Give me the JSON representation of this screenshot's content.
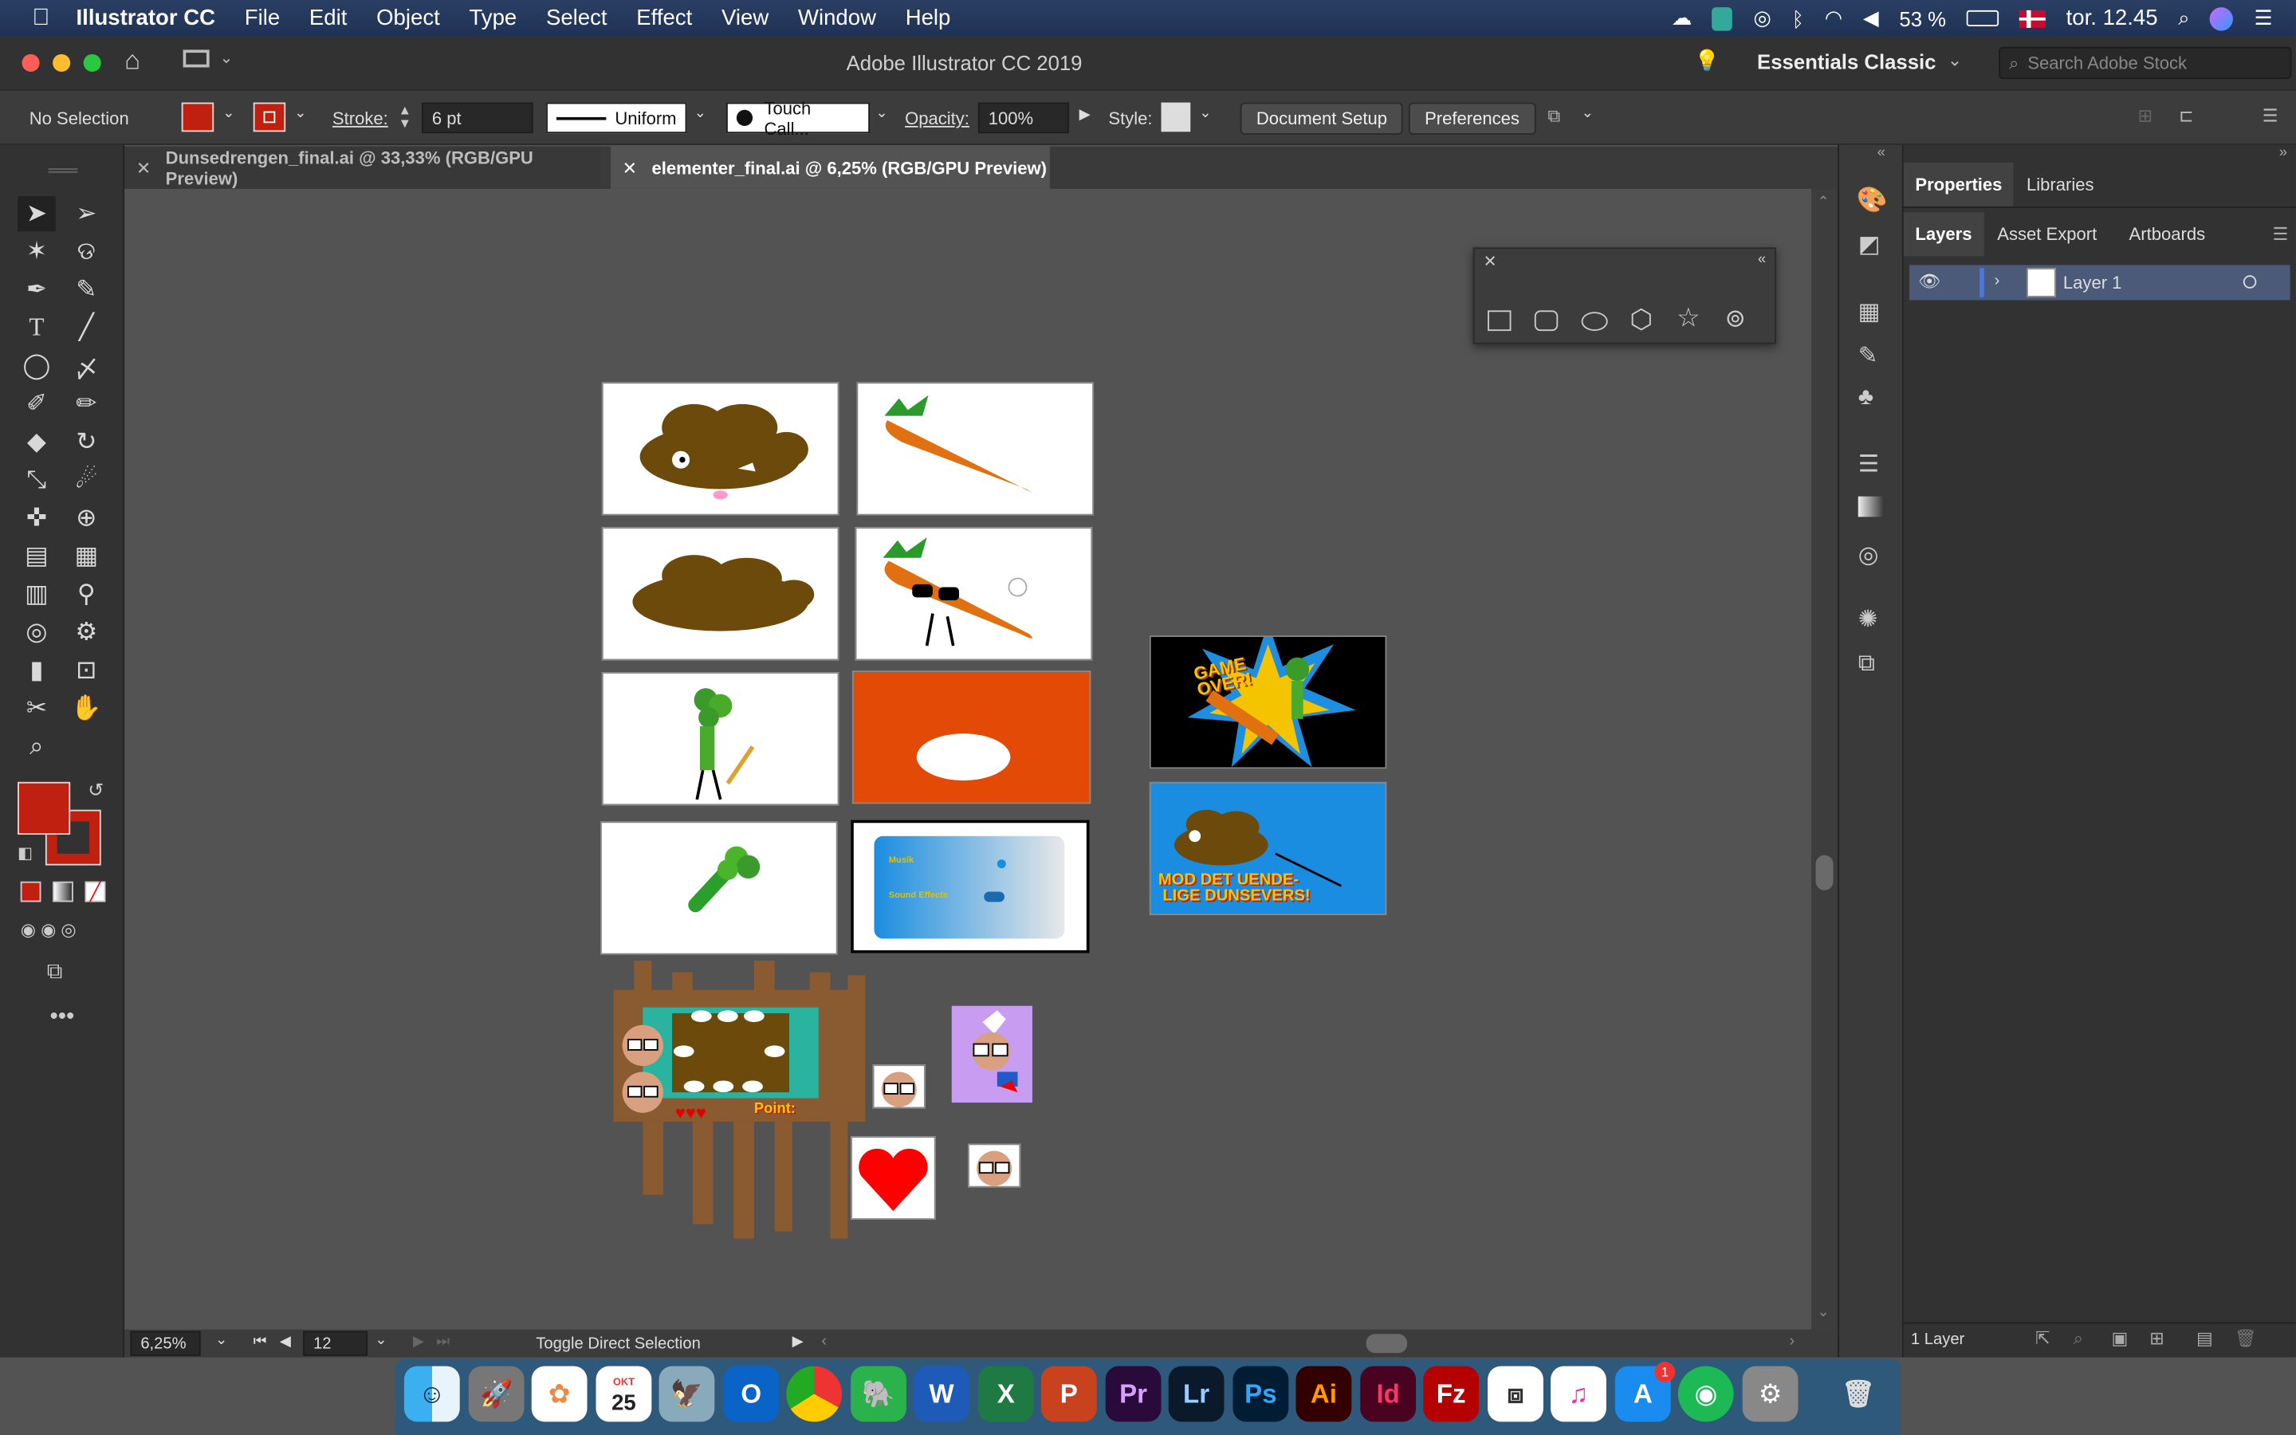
{
  "menubar": {
    "app": "Illustrator CC",
    "items": [
      "File",
      "Edit",
      "Object",
      "Type",
      "Select",
      "Effect",
      "View",
      "Window",
      "Help"
    ],
    "battery": "53 %",
    "clock": "tor. 12.45"
  },
  "titlebar": {
    "title": "Adobe Illustrator CC 2019",
    "workspace": "Essentials Classic",
    "search_placeholder": "Search Adobe Stock"
  },
  "control": {
    "selection": "No Selection",
    "stroke_label": "Stroke:",
    "stroke_value": "6 pt",
    "profile": "Uniform",
    "brush": "Touch Call...",
    "opacity_label": "Opacity:",
    "opacity_value": "100%",
    "style_label": "Style:",
    "doc_setup": "Document Setup",
    "preferences": "Preferences"
  },
  "tabs": [
    {
      "label": "Dunsedrengen_final.ai @ 33,33% (RGB/GPU Preview)"
    },
    {
      "label": "elementer_final.ai @ 6,25% (RGB/GPU Preview)"
    }
  ],
  "status": {
    "zoom": "6,25%",
    "artboard": "12",
    "message": "Toggle Direct Selection"
  },
  "panel": {
    "tabs": [
      "Properties",
      "Libraries"
    ],
    "subtabs": [
      "Layers",
      "Asset Export",
      "Artboards"
    ],
    "layer_name": "Layer 1",
    "footer": "1 Layer"
  },
  "artwork": {
    "gameover": "GAME OVER!",
    "title_line1": "MOD DET UENDE-",
    "title_line2": "LIGE DUNSEVERS!",
    "menu_music": "Musik",
    "menu_sfx": "Sound Effects",
    "points": "Point:"
  },
  "dock": {
    "calendar_month": "OKT",
    "calendar_day": "25",
    "notification": "1"
  },
  "colors": {
    "fill": "#c0200f",
    "carrot": "#e07010",
    "poop": "#6b4a0c",
    "sky": "#1a8de0",
    "orange_bg": "#e24a05"
  }
}
